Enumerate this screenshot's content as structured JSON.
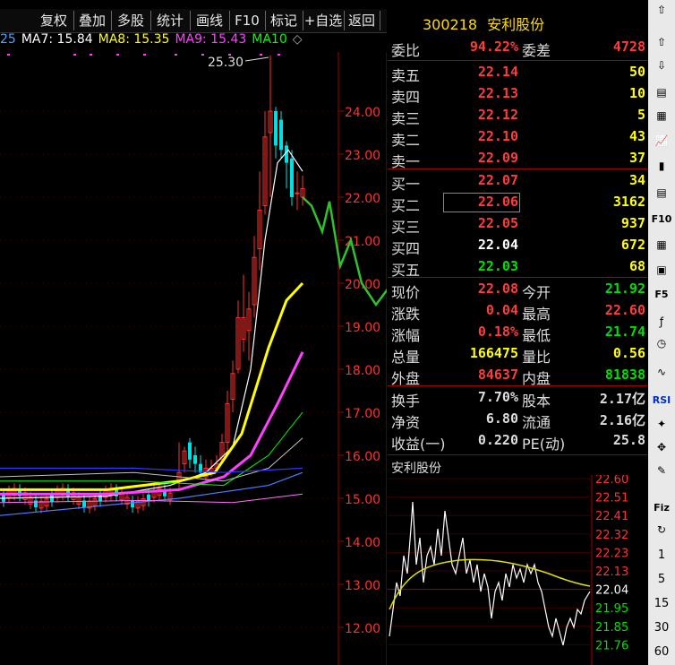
{
  "toolbar": {
    "buttons": [
      "复权",
      "叠加",
      "多股",
      "统计",
      "画线",
      "F10",
      "标记",
      "+自选",
      "返回"
    ]
  },
  "ma_legend": [
    {
      "label": "25",
      "color": "#4aa3ff"
    },
    {
      "label": "MA7: 15.84",
      "color": "#ffffff"
    },
    {
      "label": "MA8: 15.35",
      "color": "#ffff00"
    },
    {
      "label": "MA9: 15.43",
      "color": "#ff40ff"
    },
    {
      "label": "MA10",
      "color": "#00ff00"
    }
  ],
  "stock": {
    "code": "300218",
    "name": "安利股份"
  },
  "colors": {
    "up": "#ff3c3c",
    "down": "#00e000",
    "flat": "#ffffff",
    "yellow": "#ffff00",
    "grid": "#8b0000"
  },
  "order_book": {
    "weibi": {
      "label": "委比",
      "value": "94.22%",
      "label2": "委差",
      "value2": "4728"
    },
    "asks": [
      {
        "label": "卖五",
        "price": "22.14",
        "vol": "50"
      },
      {
        "label": "卖四",
        "price": "22.13",
        "vol": "10"
      },
      {
        "label": "卖三",
        "price": "22.12",
        "vol": "5"
      },
      {
        "label": "卖二",
        "price": "22.10",
        "vol": "43"
      },
      {
        "label": "卖一",
        "price": "22.09",
        "vol": "37"
      }
    ],
    "bids": [
      {
        "label": "买一",
        "price": "22.07",
        "vol": "34"
      },
      {
        "label": "买二",
        "price": "22.06",
        "vol": "3162"
      },
      {
        "label": "买三",
        "price": "22.05",
        "vol": "937"
      },
      {
        "label": "买四",
        "price": "22.04",
        "vol": "672"
      },
      {
        "label": "买五",
        "price": "22.03",
        "vol": "68"
      }
    ]
  },
  "stats": [
    {
      "l1": "现价",
      "v1": "22.08",
      "l2": "今开",
      "v2": "21.92",
      "c1": "#ff3c3c",
      "c2": "#00e000"
    },
    {
      "l1": "涨跌",
      "v1": "0.04",
      "l2": "最高",
      "v2": "22.60",
      "c1": "#ff3c3c",
      "c2": "#ff3c3c"
    },
    {
      "l1": "涨幅",
      "v1": "0.18%",
      "l2": "最低",
      "v2": "21.74",
      "c1": "#ff3c3c",
      "c2": "#00e000"
    },
    {
      "l1": "总量",
      "v1": "166475",
      "l2": "量比",
      "v2": "0.56",
      "c1": "#ffff00",
      "c2": "#ffff00"
    },
    {
      "l1": "外盘",
      "v1": "84637",
      "l2": "内盘",
      "v2": "81838",
      "c1": "#ff3c3c",
      "c2": "#00e000"
    }
  ],
  "stats2": [
    {
      "l1": "换手",
      "v1": "7.70%",
      "l2": "股本",
      "v2": "2.17亿"
    },
    {
      "l1": "净资",
      "v1": "6.80",
      "l2": "流通",
      "v2": "2.16亿"
    },
    {
      "l1": "收益(一)",
      "v1": "0.220",
      "l2": "PE(动)",
      "v2": "25.8"
    }
  ],
  "kline_axis": {
    "ticks": [
      "24.00",
      "23.00",
      "22.00",
      "21.00",
      "20.00",
      "19.00",
      "18.00",
      "17.00",
      "16.00",
      "15.00",
      "14.00",
      "13.00",
      "12.00"
    ],
    "peak_label": "25.30"
  },
  "mini_chart": {
    "title": "安利股份",
    "ticks": [
      "22.60",
      "22.51",
      "22.41",
      "22.32",
      "22.23",
      "22.13",
      "22.04",
      "21.95",
      "21.85",
      "21.76"
    ]
  },
  "right_toolbar": {
    "periods": [
      "1",
      "5",
      "15",
      "30",
      "60"
    ],
    "buttons": [
      "F10",
      "F5",
      "RSI",
      "Fiz"
    ]
  }
}
